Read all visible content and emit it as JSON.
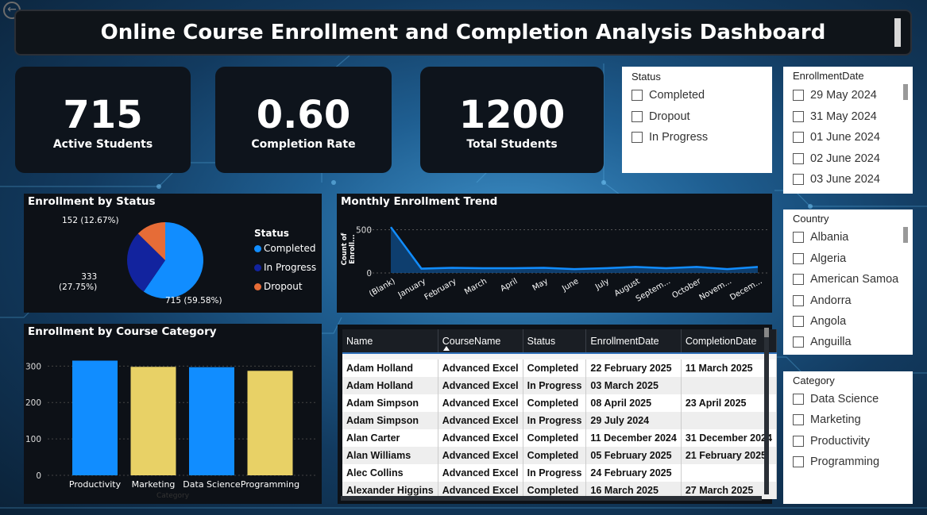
{
  "title": "Online Course Enrollment and Completion Analysis Dashboard",
  "kpis": [
    {
      "value": "715",
      "label": "Active Students"
    },
    {
      "value": "0.60",
      "label": "Completion Rate"
    },
    {
      "value": "1200",
      "label": "Total Students"
    }
  ],
  "status_slicer": {
    "title": "Status",
    "items": [
      "Completed",
      "Dropout",
      "In Progress"
    ]
  },
  "enrollment_date_slicer": {
    "title": "EnrollmentDate",
    "items": [
      "29 May 2024",
      "31 May 2024",
      "01 June 2024",
      "02 June 2024",
      "03 June 2024"
    ]
  },
  "country_slicer": {
    "title": "Country",
    "items": [
      "Albania",
      "Algeria",
      "American Samoa",
      "Andorra",
      "Angola",
      "Anguilla"
    ]
  },
  "category_slicer": {
    "title": "Category",
    "items": [
      "Data Science",
      "Marketing",
      "Productivity",
      "Programming"
    ]
  },
  "pie": {
    "title": "Enrollment by Status",
    "legend_title": "Status",
    "labels": {
      "dropout": "152 (12.67%)",
      "inprogress": "333\n(27.75%)",
      "completed": "715 (59.58%)"
    },
    "legend": [
      "Completed",
      "In Progress",
      "Dropout"
    ]
  },
  "line": {
    "title": "Monthly Enrollment Trend",
    "ylabel": "Count of Enroll...",
    "yticks": [
      "500",
      "0"
    ],
    "xticks": [
      "(Blank)",
      "January",
      "February",
      "March",
      "April",
      "May",
      "June",
      "July",
      "August",
      "Septem...",
      "October",
      "Novem...",
      "Decem..."
    ]
  },
  "bar": {
    "title": "Enrollment by Course Category",
    "xlabel": "Category",
    "yticks": [
      "300",
      "200",
      "100",
      "0"
    ]
  },
  "table": {
    "headers": [
      "Name",
      "CourseName",
      "Status",
      "EnrollmentDate",
      "CompletionDate"
    ],
    "rows": [
      [
        "Adam Holland",
        "Advanced Excel",
        "Completed",
        "22 February 2025",
        "11 March 2025"
      ],
      [
        "Adam Holland",
        "Advanced Excel",
        "In Progress",
        "03 March 2025",
        ""
      ],
      [
        "Adam Simpson",
        "Advanced Excel",
        "Completed",
        "08 April 2025",
        "23 April 2025"
      ],
      [
        "Adam Simpson",
        "Advanced Excel",
        "In Progress",
        "29 July 2024",
        ""
      ],
      [
        "Alan Carter",
        "Advanced Excel",
        "Completed",
        "11 December 2024",
        "31 December 2024"
      ],
      [
        "Alan Williams",
        "Advanced Excel",
        "Completed",
        "05 February 2025",
        "21 February 2025"
      ],
      [
        "Alec Collins",
        "Advanced Excel",
        "In Progress",
        "24 February 2025",
        ""
      ],
      [
        "Alexander Higgins",
        "Advanced Excel",
        "Completed",
        "16 March 2025",
        "27 March 2025"
      ]
    ]
  },
  "colors": {
    "blue": "#118dff",
    "navy": "#12239e",
    "orange": "#e66c37",
    "yellow": "#e8d166"
  },
  "chart_data": [
    {
      "type": "pie",
      "title": "Enrollment by Status",
      "categories": [
        "Completed",
        "In Progress",
        "Dropout"
      ],
      "values": [
        715,
        333,
        152
      ],
      "percent": [
        59.58,
        27.75,
        12.67
      ],
      "legend": "right"
    },
    {
      "type": "area",
      "title": "Monthly Enrollment Trend",
      "ylabel": "Count of Enroll...",
      "categories": [
        "(Blank)",
        "January",
        "February",
        "March",
        "April",
        "May",
        "June",
        "July",
        "August",
        "Septem...",
        "October",
        "Novem...",
        "Decem..."
      ],
      "values": [
        530,
        50,
        60,
        55,
        55,
        60,
        45,
        55,
        70,
        55,
        70,
        45,
        70
      ],
      "ylim": [
        0,
        550
      ]
    },
    {
      "type": "bar",
      "title": "Enrollment by Course Category",
      "xlabel": "Category",
      "categories": [
        "Productivity",
        "Marketing",
        "Data Science",
        "Programming"
      ],
      "values": [
        315,
        298,
        297,
        287
      ],
      "ylim": [
        0,
        340
      ],
      "grid": true
    }
  ]
}
